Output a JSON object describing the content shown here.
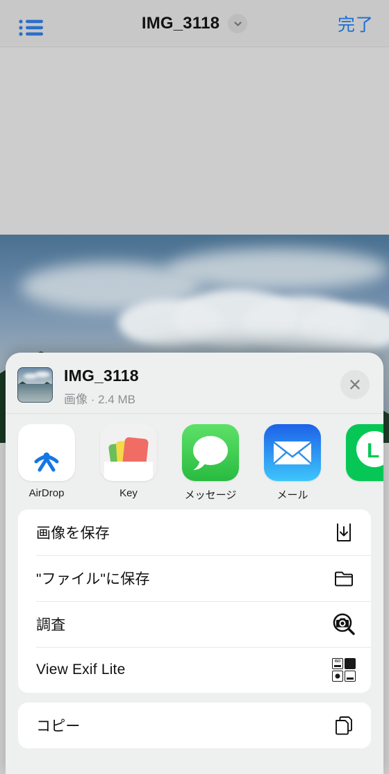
{
  "navbar": {
    "list_icon": "list-bullet-icon",
    "title": "IMG_3118",
    "chevron_icon": "chevron-down-icon",
    "done_label": "完了",
    "done_color": "#1a6fd4"
  },
  "share_sheet": {
    "header": {
      "thumbnail": "photo-thumbnail",
      "file_name": "IMG_3118",
      "file_meta": "画像 · 2.4 MB",
      "close_icon": "close-icon"
    },
    "apps": [
      {
        "name": "airdrop",
        "label": "AirDrop",
        "icon": "airdrop-icon"
      },
      {
        "name": "key",
        "label": "Key",
        "icon": "wallet-cards-icon"
      },
      {
        "name": "messages",
        "label": "メッセージ",
        "icon": "message-bubble-icon"
      },
      {
        "name": "mail",
        "label": "メール",
        "icon": "envelope-icon"
      },
      {
        "name": "line",
        "label": "",
        "icon": "line-icon"
      }
    ],
    "actions_primary": [
      {
        "name": "save-image",
        "label": "画像を保存",
        "icon": "download-icon"
      },
      {
        "name": "save-to-files",
        "label": "\"ファイル\"に保存",
        "icon": "folder-icon"
      },
      {
        "name": "look-up",
        "label": "調査",
        "icon": "camera-search-icon"
      },
      {
        "name": "view-exif-lite",
        "label": "View Exif Lite",
        "icon": "exif-grid-icon"
      }
    ],
    "actions_secondary": [
      {
        "name": "copy",
        "label": "コピー",
        "icon": "copy-documents-icon"
      }
    ]
  },
  "colors": {
    "accent_blue": "#1a6fd4",
    "sheet_bg": "#eef0ef",
    "card_bg": "#ffffff",
    "backdrop_gray": "#cdcdcd"
  }
}
